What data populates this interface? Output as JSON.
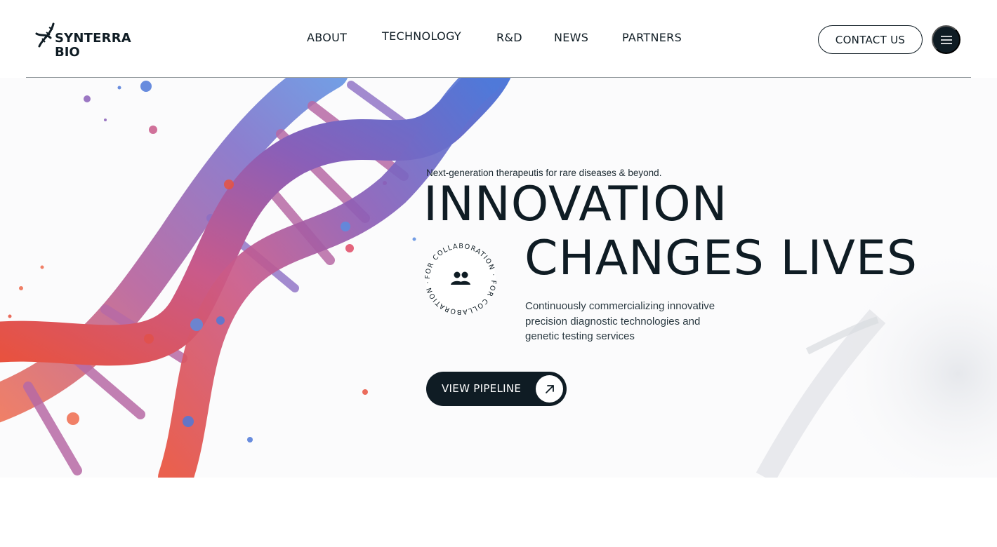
{
  "brand": {
    "line1": "SYNTERRA",
    "line2": "BIO"
  },
  "nav": {
    "items": [
      {
        "label": "ABOUT"
      },
      {
        "label": "TECHNOLOGY"
      },
      {
        "label": "R&D"
      },
      {
        "label": "NEWS"
      },
      {
        "label": "PARTNERS"
      }
    ]
  },
  "header": {
    "contact_label": "CONTACT US",
    "menu_icon": "hamburger-icon"
  },
  "hero": {
    "tagline": "Next-generation therapeutis for rare diseases & beyond.",
    "headline_line1": "INNOVATION",
    "headline_line2": "CHANGES LIVES",
    "badge_text": "FOR COLLABORATION · FOR COLLABORATION · ",
    "badge_icon": "people-icon",
    "description": "Continuously commercializing innovative precision diagnostic technologies and genetic testing services",
    "cta_label": "VIEW PIPELINE",
    "cta_icon": "arrow-up-right-icon"
  },
  "colors": {
    "primary": "#0f1c24",
    "background": "#ffffff",
    "dna_blue": "#4f6fd6",
    "dna_purple": "#9b5aa8",
    "dna_red": "#e0504a"
  }
}
